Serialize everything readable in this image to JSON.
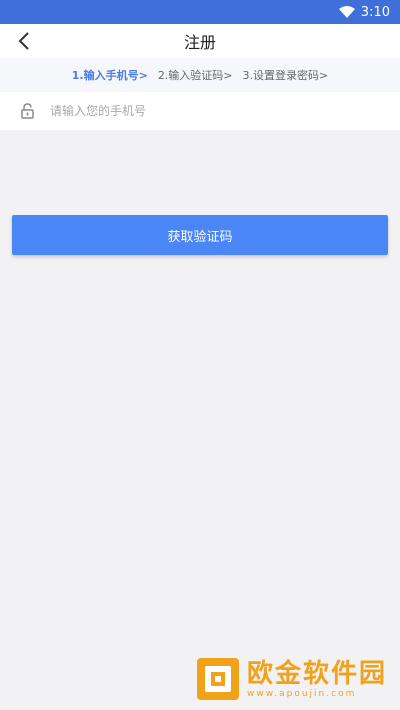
{
  "status_bar": {
    "time": "3:10"
  },
  "app_bar": {
    "title": "注册"
  },
  "steps": [
    {
      "label": "1.输入手机号>",
      "active": true
    },
    {
      "label": "2.输入验证码>",
      "active": false
    },
    {
      "label": "3.设置登录密码>",
      "active": false
    }
  ],
  "phone_field": {
    "placeholder": "请输入您的手机号",
    "value": ""
  },
  "actions": {
    "get_code_label": "获取验证码"
  },
  "watermark": {
    "title": "欧金软件园",
    "url": "www.apoujin.com"
  },
  "colors": {
    "primary": "#4b86f6",
    "status_bar": "#3f6fd8",
    "active_step": "#4a7de2",
    "watermark": "#f0a21b"
  }
}
